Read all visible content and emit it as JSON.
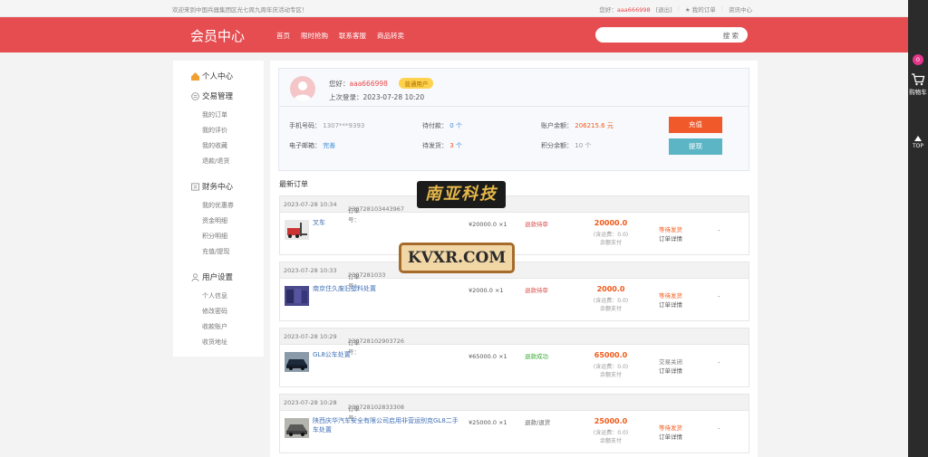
{
  "topbar": {
    "welcome": "欢迎来到中国兵器集团区光七周九周年庆活动专区！",
    "hello_prefix": "您好：",
    "username": "aaa666998",
    "logout": "[退出]",
    "my_orders": "★ 我的订单",
    "info_center": "资讯中心"
  },
  "header": {
    "title": "会员中心",
    "nav": [
      "首页",
      "限时抢购",
      "联系客服",
      "商品转卖"
    ],
    "search_placeholder": "",
    "search_button": "搜 索"
  },
  "rightbar": {
    "cart_count": "0",
    "cart_label": "购物车",
    "top_label": "TOP"
  },
  "sidebar": {
    "personal_center": "个人中心",
    "trade": {
      "title": "交易管理",
      "items": [
        "我的订单",
        "我的评价",
        "我的收藏",
        "退款/退货"
      ]
    },
    "finance": {
      "title": "财务中心",
      "items": [
        "我的优惠券",
        "资金明细",
        "积分明细",
        "充值/提现"
      ]
    },
    "user": {
      "title": "用户设置",
      "items": [
        "个人信息",
        "修改密码",
        "收款账户",
        "收货地址"
      ]
    }
  },
  "profile": {
    "hello": "您好：",
    "username": "aaa666998",
    "level": "普通用户",
    "last_login_label": "上次登录：",
    "last_login": "2023-07-28 10:20",
    "phone_label": "手机号码：",
    "phone": "1307***9393",
    "email_label": "电子邮箱：",
    "email": "完善",
    "pending_pay_label": "待付款：",
    "pending_pay": "0",
    "pending_ship_label": "待发货：",
    "pending_ship": "3",
    "unit_ge": "个",
    "balance_label": "账户余额：",
    "balance": "206215.6",
    "unit_yuan": "元",
    "points_label": "积分余额：",
    "points": "10",
    "charge_button": "充值",
    "withdraw_button": "提现"
  },
  "orders_title": "最新订单",
  "orders": [
    {
      "time": "2023-07-28 10:34",
      "order_no_label": "订单号：",
      "order_no": "230728103443967",
      "name": "叉车",
      "price": "¥20000.0 ×1",
      "status": "退款待审",
      "total": "20000.0",
      "freight": "(含运费：0.0)",
      "pay": "余额支付",
      "op1": "等待发货",
      "op2": "订单详情",
      "extra": "-"
    },
    {
      "time": "2023-07-28 10:33",
      "order_no_label": "订单号：",
      "order_no": "2307281033",
      "name": "南京住久废旧塑料处置",
      "price": "¥2000.0 ×1",
      "status": "退款待审",
      "total": "2000.0",
      "freight": "(含运费：0.0)",
      "pay": "余额支付",
      "op1": "等待发货",
      "op2": "订单详情",
      "extra": "-"
    },
    {
      "time": "2023-07-28 10:29",
      "order_no_label": "订单号：",
      "order_no": "230728102903726",
      "name": "GL8公车处置",
      "price": "¥65000.0 ×1",
      "status": "退款成功",
      "total": "65000.0",
      "freight": "(含运费：0.0)",
      "pay": "余额支付",
      "op1": "交易关闭",
      "op2": "订单详情",
      "extra": "-"
    },
    {
      "time": "2023-07-28 10:28",
      "order_no_label": "订单号：",
      "order_no": "230728102833308",
      "name": "陕西庆华汽车安全有限公司启用非营运别克GL8二手车处置",
      "price": "¥25000.0 ×1",
      "status": "退款/退货",
      "total": "25000.0",
      "freight": "(含运费：0.0)",
      "pay": "余额支付",
      "op1": "等待发货",
      "op2": "订单详情",
      "extra": "-"
    }
  ],
  "watermark": {
    "logo_text": "南亚科技",
    "site": "KVXR.COM"
  }
}
